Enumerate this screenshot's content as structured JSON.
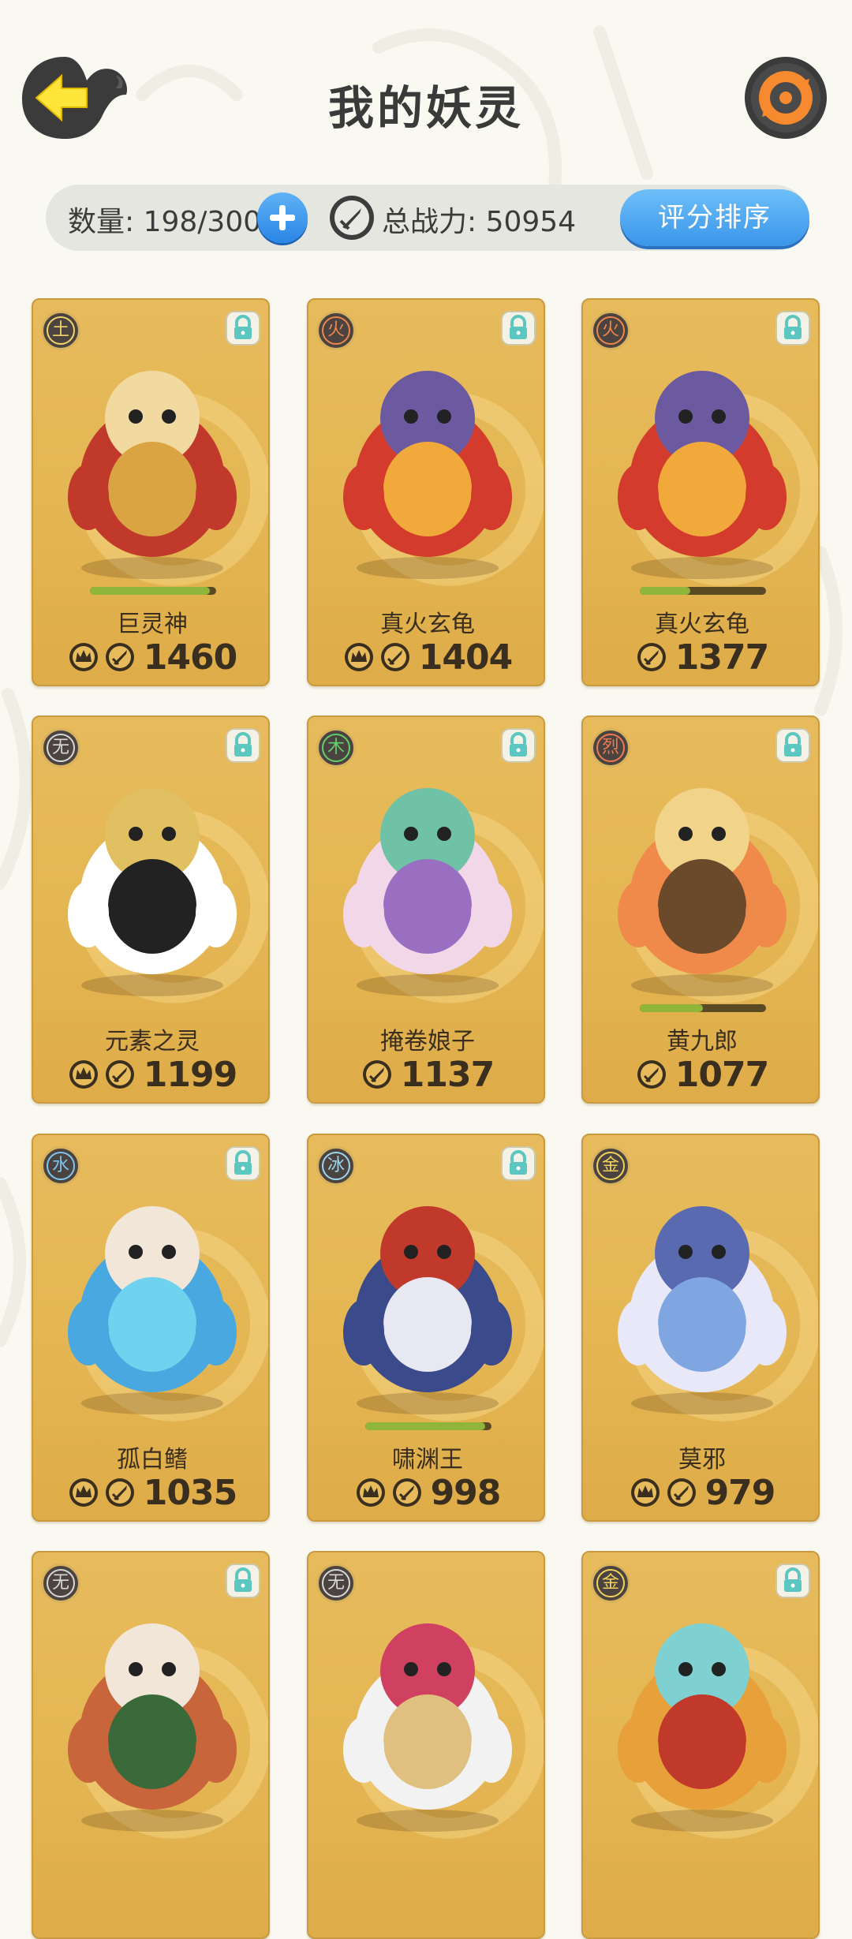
{
  "header": {
    "title": "我的妖灵",
    "back_icon": "back-arrow-icon",
    "refresh_icon": "refresh-icon"
  },
  "stats": {
    "count_label": "数量: 198/300",
    "power_label": "总战力: 50954",
    "sort_label": "评分排序"
  },
  "cards": [
    {
      "element": "土",
      "element_color": "#f1d56a",
      "name": "巨灵神",
      "power": "1460",
      "crown": true,
      "hp": 0.95,
      "hp_visible": true,
      "locked": true
    },
    {
      "element": "火",
      "element_color": "#f0864a",
      "name": "真火玄龟",
      "power": "1404",
      "crown": true,
      "hp": 0,
      "hp_visible": false,
      "locked": true
    },
    {
      "element": "火",
      "element_color": "#f0864a",
      "name": "真火玄龟",
      "power": "1377",
      "crown": false,
      "hp": 0.4,
      "hp_visible": true,
      "locked": true
    },
    {
      "element": "无",
      "element_color": "#d8d8d8",
      "name": "元素之灵",
      "power": "1199",
      "crown": true,
      "hp": 0,
      "hp_visible": false,
      "locked": true
    },
    {
      "element": "木",
      "element_color": "#62d06a",
      "name": "掩卷娘子",
      "power": "1137",
      "crown": false,
      "hp": 0,
      "hp_visible": false,
      "locked": true
    },
    {
      "element": "烈",
      "element_color": "#f07a52",
      "name": "黄九郎",
      "power": "1077",
      "crown": false,
      "hp": 0.5,
      "hp_visible": true,
      "locked": true
    },
    {
      "element": "水",
      "element_color": "#7fc6f2",
      "name": "孤白鳍",
      "power": "1035",
      "crown": true,
      "hp": 0,
      "hp_visible": false,
      "locked": true
    },
    {
      "element": "冰",
      "element_color": "#9fd6ee",
      "name": "啸渊王",
      "power": "998",
      "crown": true,
      "hp": 0.95,
      "hp_visible": true,
      "locked": true
    },
    {
      "element": "金",
      "element_color": "#f2d35a",
      "name": "莫邪",
      "power": "979",
      "crown": true,
      "hp": 0,
      "hp_visible": false,
      "locked": false
    },
    {
      "element": "无",
      "element_color": "#d8d8d8",
      "name": "",
      "power": "",
      "crown": false,
      "hp": 0,
      "hp_visible": false,
      "locked": true
    },
    {
      "element": "无",
      "element_color": "#d8d8d8",
      "name": "",
      "power": "",
      "crown": false,
      "hp": 0,
      "hp_visible": false,
      "locked": false
    },
    {
      "element": "金",
      "element_color": "#f2d35a",
      "name": "",
      "power": "",
      "crown": false,
      "hp": 0,
      "hp_visible": false,
      "locked": true
    }
  ]
}
